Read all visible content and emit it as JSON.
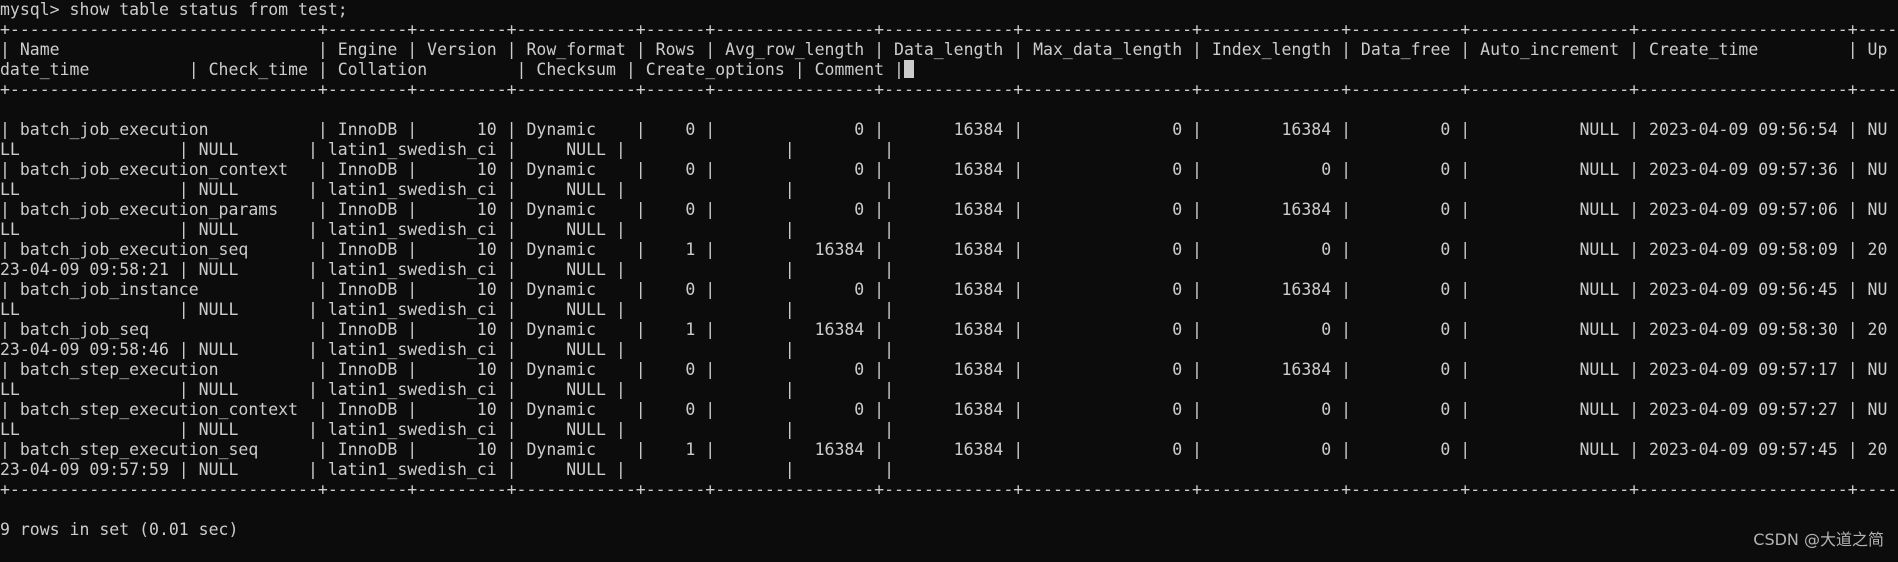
{
  "console": {
    "lines": [
      "mysql> show table status from test;",
      "+-------------------------------+--------+---------+------------+------+----------------+-------------+-----------------+--------------+-----------+----------------+---------------------+---------------------+------------+-------------------+----------+----------------+---------+",
      "| Name                          | Engine | Version | Row_format | Rows | Avg_row_length | Data_length | Max_data_length | Index_length | Data_free | Auto_increment | Create_time         | Up",
      "date_time          | Check_time | Collation         | Checksum | Create_options | Comment |",
      "+-------------------------------+--------+---------+------------+------+----------------+-------------+-----------------+--------------+-----------+----------------+---------------------+---------------------+",
      "",
      "| batch_job_execution           | InnoDB |      10 | Dynamic    |    0 |              0 |       16384 |               0 |        16384 |         0 |           NULL | 2023-04-09 09:56:54 | NU",
      "LL                | NULL       | latin1_swedish_ci |     NULL |                |         |",
      "| batch_job_execution_context   | InnoDB |      10 | Dynamic    |    0 |              0 |       16384 |               0 |            0 |         0 |           NULL | 2023-04-09 09:57:36 | NU",
      "LL                | NULL       | latin1_swedish_ci |     NULL |                |         |",
      "| batch_job_execution_params    | InnoDB |      10 | Dynamic    |    0 |              0 |       16384 |               0 |        16384 |         0 |           NULL | 2023-04-09 09:57:06 | NU",
      "LL                | NULL       | latin1_swedish_ci |     NULL |                |         |",
      "| batch_job_execution_seq       | InnoDB |      10 | Dynamic    |    1 |          16384 |       16384 |               0 |            0 |         0 |           NULL | 2023-04-09 09:58:09 | 20",
      "23-04-09 09:58:21 | NULL       | latin1_swedish_ci |     NULL |                |         |",
      "| batch_job_instance            | InnoDB |      10 | Dynamic    |    0 |              0 |       16384 |               0 |        16384 |         0 |           NULL | 2023-04-09 09:56:45 | NU",
      "LL                | NULL       | latin1_swedish_ci |     NULL |                |         |",
      "| batch_job_seq                 | InnoDB |      10 | Dynamic    |    1 |          16384 |       16384 |               0 |            0 |         0 |           NULL | 2023-04-09 09:58:30 | 20",
      "23-04-09 09:58:46 | NULL       | latin1_swedish_ci |     NULL |                |         |",
      "| batch_step_execution          | InnoDB |      10 | Dynamic    |    0 |              0 |       16384 |               0 |        16384 |         0 |           NULL | 2023-04-09 09:57:17 | NU",
      "LL                | NULL       | latin1_swedish_ci |     NULL |                |         |",
      "| batch_step_execution_context  | InnoDB |      10 | Dynamic    |    0 |              0 |       16384 |               0 |            0 |         0 |           NULL | 2023-04-09 09:57:27 | NU",
      "LL                | NULL       | latin1_swedish_ci |     NULL |                |         |",
      "| batch_step_execution_seq      | InnoDB |      10 | Dynamic    |    1 |          16384 |       16384 |               0 |            0 |         0 |           NULL | 2023-04-09 09:57:45 | 20",
      "23-04-09 09:57:59 | NULL       | latin1_swedish_ci |     NULL |                |         |",
      "+-------------------------------+--------+---------+------------+------+----------------+-------------+-----------------+--------------+-----------+----------------+---------------------+---------------------+",
      "",
      "9 rows in set (0.01 sec)"
    ]
  },
  "watermark": "CSDN @大道之简"
}
